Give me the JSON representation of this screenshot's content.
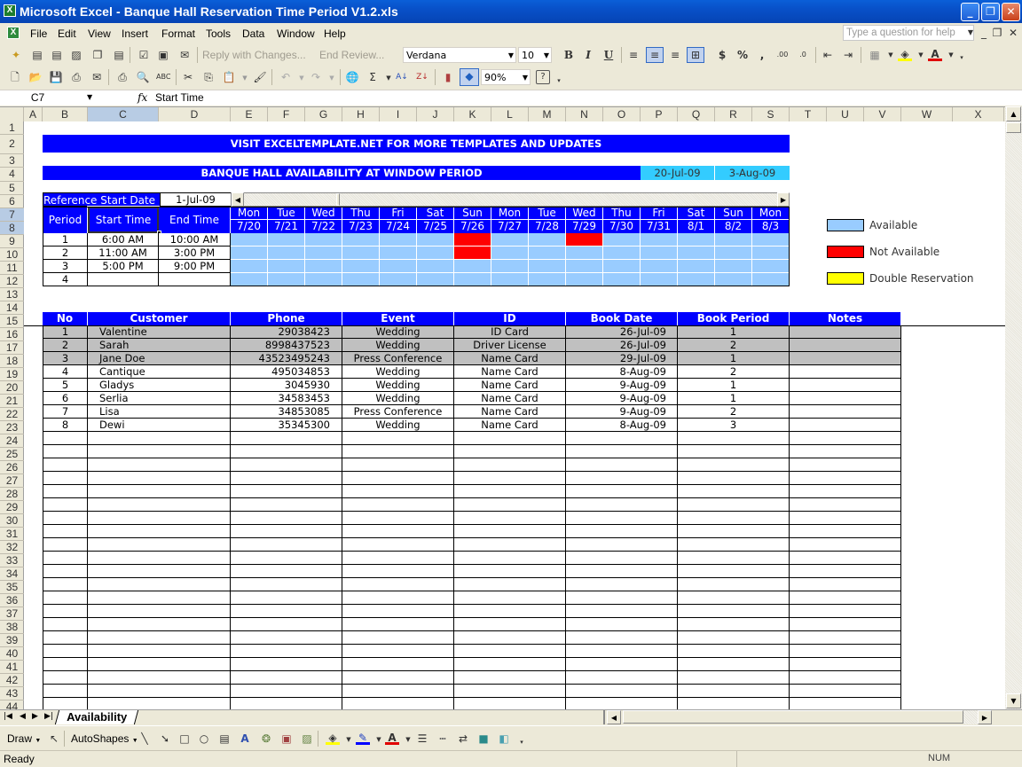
{
  "window": {
    "title": "Microsoft Excel - Banque Hall Reservation Time Period V1.2.xls"
  },
  "menu": {
    "items": [
      "File",
      "Edit",
      "View",
      "Insert",
      "Format",
      "Tools",
      "Data",
      "Window",
      "Help"
    ],
    "help_placeholder": "Type a question for help"
  },
  "toolbar": {
    "reply_changes": "Reply with Changes...",
    "end_review": "End Review...",
    "font_name": "Verdana",
    "font_size": "10",
    "zoom": "90%",
    "icons": [
      "new-icon",
      "open-icon",
      "save-icon",
      "permission-icon",
      "email-icon",
      "print-icon",
      "print-preview-icon",
      "spelling-icon",
      "cut-icon",
      "copy-icon",
      "paste-icon",
      "format-painter-icon",
      "undo-icon",
      "redo-icon",
      "hyperlink-icon",
      "autosum-icon",
      "sort-ascending-icon",
      "sort-descending-icon",
      "chart-wizard-icon",
      "drawing-icon",
      "help-icon",
      "bold-icon",
      "italic-icon",
      "underline-icon",
      "align-left-icon",
      "align-center-icon",
      "align-right-icon",
      "merge-center-icon",
      "currency-icon",
      "percent-icon",
      "comma-icon",
      "increase-decimal-icon",
      "decrease-decimal-icon",
      "decrease-indent-icon",
      "increase-indent-icon",
      "borders-icon",
      "fill-color-icon",
      "font-color-icon"
    ]
  },
  "formula_bar": {
    "name_box": "C7",
    "fx": "fx",
    "content": "Start Time"
  },
  "columns": [
    "A",
    "B",
    "C",
    "D",
    "E",
    "F",
    "G",
    "H",
    "I",
    "J",
    "K",
    "L",
    "M",
    "N",
    "O",
    "P",
    "Q",
    "R",
    "S",
    "T",
    "U",
    "V",
    "W",
    "X"
  ],
  "selected_column": "C",
  "rows": [
    "1",
    "2",
    "3",
    "4",
    "5",
    "6",
    "7",
    "8",
    "9",
    "10",
    "11",
    "12",
    "13",
    "14",
    "15",
    "16",
    "17",
    "18",
    "19",
    "20",
    "21",
    "22",
    "23",
    "24",
    "25",
    "26",
    "27",
    "28",
    "29",
    "30",
    "31",
    "32",
    "33",
    "34",
    "35",
    "36",
    "37",
    "38",
    "39",
    "40",
    "41",
    "42",
    "43",
    "44"
  ],
  "sheet": {
    "banner": "VISIT EXCELTEMPLATE.NET FOR MORE TEMPLATES AND UPDATES",
    "availability_title": "BANQUE HALL AVAILABILITY AT WINDOW PERIOD",
    "window_start": "20-Jul-09",
    "window_end": "3-Aug-09",
    "ref_label": "Reference Start Date",
    "ref_value": "1-Jul-09",
    "period_headers": {
      "period": "Period",
      "start": "Start Time",
      "end": "End Time"
    },
    "periods": [
      {
        "no": "1",
        "start": "6:00 AM",
        "end": "10:00 AM"
      },
      {
        "no": "2",
        "start": "11:00 AM",
        "end": "3:00 PM"
      },
      {
        "no": "3",
        "start": "5:00 PM",
        "end": "9:00 PM"
      },
      {
        "no": "4",
        "start": "",
        "end": ""
      }
    ],
    "days": [
      {
        "dow": "Mon",
        "date": "7/20"
      },
      {
        "dow": "Tue",
        "date": "7/21"
      },
      {
        "dow": "Wed",
        "date": "7/22"
      },
      {
        "dow": "Thu",
        "date": "7/23"
      },
      {
        "dow": "Fri",
        "date": "7/24"
      },
      {
        "dow": "Sat",
        "date": "7/25"
      },
      {
        "dow": "Sun",
        "date": "7/26"
      },
      {
        "dow": "Mon",
        "date": "7/27"
      },
      {
        "dow": "Tue",
        "date": "7/28"
      },
      {
        "dow": "Wed",
        "date": "7/29"
      },
      {
        "dow": "Thu",
        "date": "7/30"
      },
      {
        "dow": "Fri",
        "date": "7/31"
      },
      {
        "dow": "Sat",
        "date": "8/1"
      },
      {
        "dow": "Sun",
        "date": "8/2"
      },
      {
        "dow": "Mon",
        "date": "8/3"
      }
    ],
    "availability_grid": [
      [
        "A",
        "A",
        "A",
        "A",
        "A",
        "A",
        "N",
        "A",
        "A",
        "N",
        "A",
        "A",
        "A",
        "A",
        "A"
      ],
      [
        "A",
        "A",
        "A",
        "A",
        "A",
        "A",
        "N",
        "A",
        "A",
        "A",
        "A",
        "A",
        "A",
        "A",
        "A"
      ],
      [
        "A",
        "A",
        "A",
        "A",
        "A",
        "A",
        "A",
        "A",
        "A",
        "A",
        "A",
        "A",
        "A",
        "A",
        "A"
      ],
      [
        "A",
        "A",
        "A",
        "A",
        "A",
        "A",
        "A",
        "A",
        "A",
        "A",
        "A",
        "A",
        "A",
        "A",
        "A"
      ]
    ],
    "legend": [
      {
        "label": "Available",
        "color": "#99ccff"
      },
      {
        "label": "Not Available",
        "color": "#ff0000"
      },
      {
        "label": "Double Reservation",
        "color": "#ffff00"
      }
    ],
    "booking_headers": [
      "No",
      "Customer",
      "Phone",
      "Event",
      "ID",
      "Book Date",
      "Book Period",
      "Notes"
    ],
    "bookings": [
      {
        "no": "1",
        "customer": "Valentine",
        "phone": "29038423",
        "event": "Wedding",
        "id": "ID Card",
        "date": "26-Jul-09",
        "period": "1",
        "notes": "",
        "highlight": true
      },
      {
        "no": "2",
        "customer": "Sarah",
        "phone": "8998437523",
        "event": "Wedding",
        "id": "Driver License",
        "date": "26-Jul-09",
        "period": "2",
        "notes": "",
        "highlight": true
      },
      {
        "no": "3",
        "customer": "Jane Doe",
        "phone": "43523495243",
        "event": "Press Conference",
        "id": "Name Card",
        "date": "29-Jul-09",
        "period": "1",
        "notes": "",
        "highlight": true
      },
      {
        "no": "4",
        "customer": "Cantique",
        "phone": "495034853",
        "event": "Wedding",
        "id": "Name Card",
        "date": "8-Aug-09",
        "period": "2",
        "notes": "",
        "highlight": false
      },
      {
        "no": "5",
        "customer": "Gladys",
        "phone": "3045930",
        "event": "Wedding",
        "id": "Name Card",
        "date": "9-Aug-09",
        "period": "1",
        "notes": "",
        "highlight": false
      },
      {
        "no": "6",
        "customer": "Serlia",
        "phone": "34583453",
        "event": "Wedding",
        "id": "Name Card",
        "date": "9-Aug-09",
        "period": "1",
        "notes": "",
        "highlight": false
      },
      {
        "no": "7",
        "customer": "Lisa",
        "phone": "34853085",
        "event": "Press Conference",
        "id": "Name Card",
        "date": "9-Aug-09",
        "period": "2",
        "notes": "",
        "highlight": false
      },
      {
        "no": "8",
        "customer": "Dewi",
        "phone": "35345300",
        "event": "Wedding",
        "id": "Name Card",
        "date": "8-Aug-09",
        "period": "3",
        "notes": "",
        "highlight": false
      }
    ],
    "empty_rows": 21
  },
  "colors": {
    "banner_blue": "#0000ff",
    "date_cyan": "#33ccff",
    "highlight_gray": "#c0c0c0"
  },
  "sheet_tabs": [
    "Availability"
  ],
  "draw_toolbar": {
    "draw": "Draw",
    "autoshapes": "AutoShapes"
  },
  "status": {
    "left": "Ready",
    "num": "NUM"
  }
}
